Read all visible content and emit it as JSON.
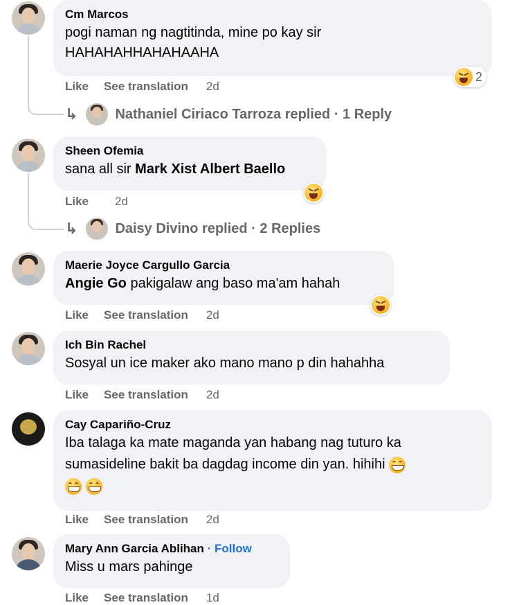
{
  "comments": [
    {
      "author": "Cm Marcos",
      "text_line1": "pogi naman ng nagtitinda, mine po kay sir",
      "text_line2": "HAHAHAHHAHAHAAHA",
      "like": "Like",
      "see_translation": "See translation",
      "time": "2d",
      "reaction_count": "2",
      "replies_text": "Nathaniel Ciriaco Tarroza replied · 1 Reply"
    },
    {
      "author": "Sheen Ofemia",
      "text_prefix": "sana all sir ",
      "mention": "Mark Xist Albert Baello",
      "like": "Like",
      "time": "2d",
      "replies_text": "Daisy Divino replied · 2 Replies"
    },
    {
      "author": "Maerie Joyce Cargullo Garcia",
      "mention": "Angie Go",
      "text_suffix": " pakigalaw ang baso ma'am hahah",
      "like": "Like",
      "see_translation": "See translation",
      "time": "2d"
    },
    {
      "author": "Ich Bin Rachel",
      "text": "Sosyal un ice maker ako mano mano p din hahahha",
      "like": "Like",
      "see_translation": "See translation",
      "time": "2d"
    },
    {
      "author": "Cay Capariño-Cruz",
      "text_line1": "Iba talaga ka mate maganda yan habang nag tuturo ka",
      "text_line2": "sumasideline bakit ba dagdag income din yan. hihihi",
      "like": "Like",
      "see_translation": "See translation",
      "time": "2d"
    },
    {
      "author": "Mary Ann Garcia Ablihan",
      "follow_sep": " · ",
      "follow": "Follow",
      "text": "Miss u mars pahinge",
      "like": "Like",
      "see_translation": "See translation",
      "time": "1d"
    }
  ],
  "icons": {
    "reply_arrow": "reply-arrow-icon",
    "laugh": "laughing-emoji-icon",
    "grin": "grinning-emoji-icon"
  },
  "colors": {
    "bubble": "#f0f2f5",
    "secondary_text": "#65676b",
    "link": "#216fdb"
  }
}
